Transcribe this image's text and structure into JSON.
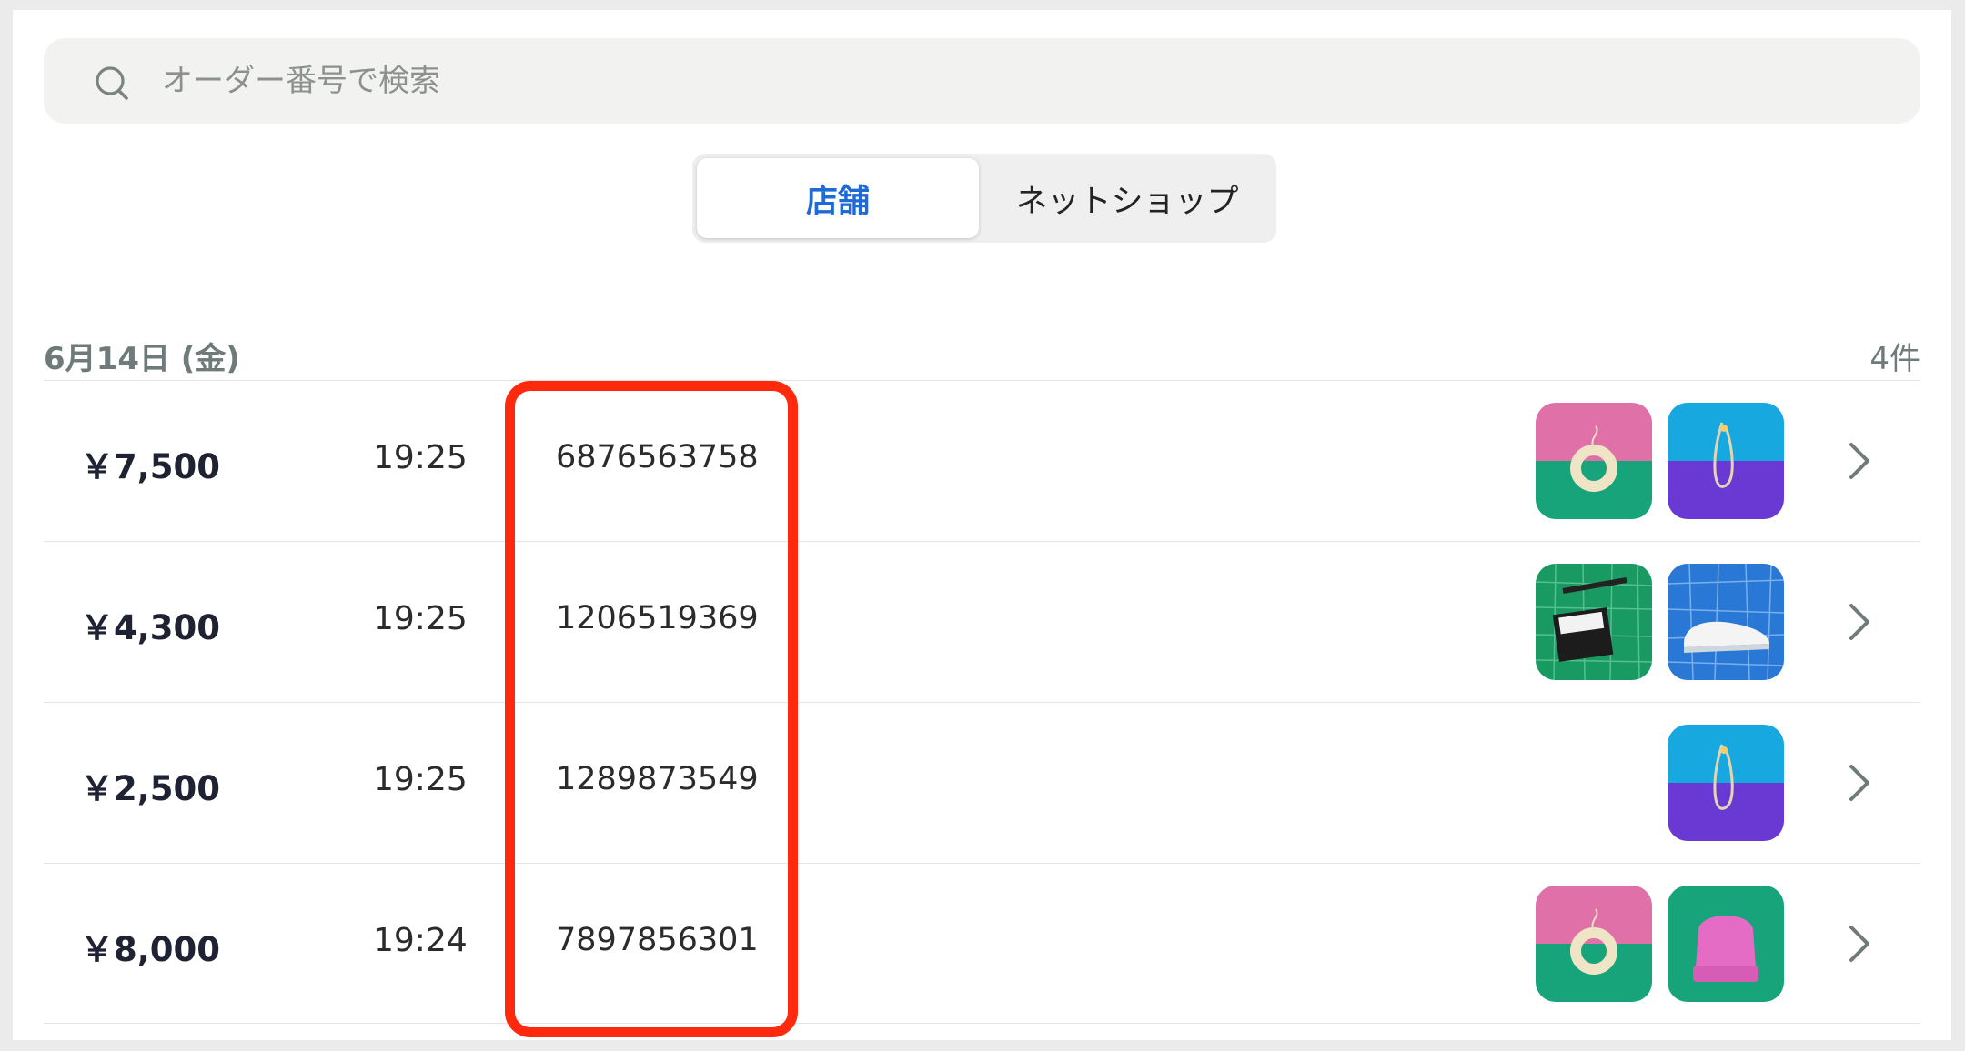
{
  "search": {
    "placeholder": "オーダー番号で検索",
    "icon": "search-icon"
  },
  "tabs": [
    {
      "label": "店舗",
      "active": true
    },
    {
      "label": "ネットショップ",
      "active": false
    }
  ],
  "colors": {
    "accent": "#1f6bd6",
    "highlight": "#ff2a0d"
  },
  "group": {
    "date": "6月14日 (金)",
    "count": "4件"
  },
  "orders": [
    {
      "amount": "￥7,500",
      "time": "19:25",
      "order_no": "6876563758",
      "items": [
        "donut-on-pink-green",
        "necklace-on-cyan-purple"
      ]
    },
    {
      "amount": "￥4,300",
      "time": "19:25",
      "order_no": "1206519369",
      "items": [
        "bag-on-green-grid",
        "sneaker-on-blue-grid"
      ]
    },
    {
      "amount": "￥2,500",
      "time": "19:25",
      "order_no": "1289873549",
      "items": [
        "necklace-on-cyan-purple"
      ]
    },
    {
      "amount": "￥8,000",
      "time": "19:24",
      "order_no": "7897856301",
      "items": [
        "donut-on-pink-green",
        "beanie-on-green"
      ]
    }
  ]
}
